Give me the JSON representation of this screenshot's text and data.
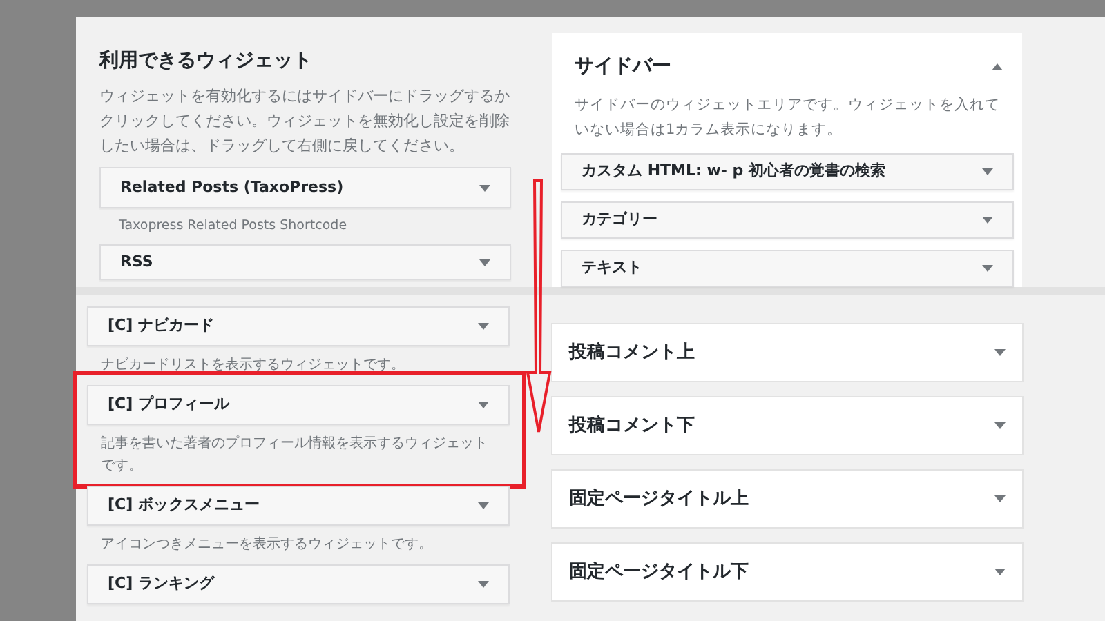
{
  "available_widgets": {
    "title": "利用できるウィジェット",
    "description": "ウィジェットを有効化するにはサイドバーにドラッグするかクリックしてください。ウィジェットを無効化し設定を削除したい場合は、ドラッグして右側に戻してください。",
    "widgets": [
      {
        "name": "Related Posts (TaxoPress)",
        "description": "Taxopress Related Posts Shortcode"
      },
      {
        "name": "RSS"
      }
    ]
  },
  "sidebar": {
    "title": "サイドバー",
    "expanded": true,
    "description": "サイドバーのウィジェットエリアです。ウィジェットを入れていない場合は1カラム表示になります。",
    "widgets": [
      "カスタム HTML: w- p 初心者の覚書の検索",
      "カテゴリー",
      "テキスト"
    ]
  },
  "more_widgets": [
    {
      "name": "[C] ナビカード",
      "description": "ナビカードリストを表示するウィジェットです。",
      "highlighted": false
    },
    {
      "name": "[C] プロフィール",
      "description": "記事を書いた著者のプロフィール情報を表示するウィジェットです。",
      "highlighted": true
    },
    {
      "name": "[C] ボックスメニュー",
      "description": "アイコンつきメニューを表示するウィジェットです。",
      "highlighted": false
    },
    {
      "name": "[C] ランキング",
      "highlighted": false
    }
  ],
  "widget_areas": [
    {
      "title": "投稿コメント上",
      "expanded": false
    },
    {
      "title": "投稿コメント下",
      "expanded": false
    },
    {
      "title": "固定ページタイトル上",
      "expanded": false
    },
    {
      "title": "固定ページタイトル下",
      "expanded": false
    }
  ]
}
